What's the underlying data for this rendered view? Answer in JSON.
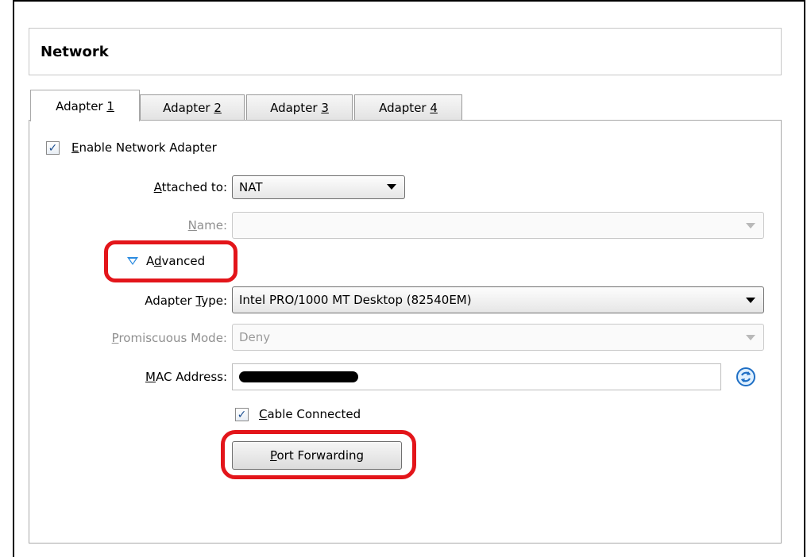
{
  "section": {
    "title": "Network"
  },
  "tabs": [
    {
      "prefix": "Adapter ",
      "key": "1"
    },
    {
      "prefix": "Adapter ",
      "key": "2"
    },
    {
      "prefix": "Adapter ",
      "key": "3"
    },
    {
      "prefix": "Adapter ",
      "key": "4"
    }
  ],
  "enable_adapter": {
    "label_key": "E",
    "label_rest": "nable Network Adapter",
    "checked": true
  },
  "attached_to": {
    "label_key": "A",
    "label_rest": "ttached to:",
    "value": "NAT"
  },
  "name": {
    "label_key": "N",
    "label_rest": "ame:",
    "value": ""
  },
  "advanced": {
    "label_pre": "A",
    "label_key": "d",
    "label_rest": "vanced"
  },
  "adapter_type": {
    "label_pre": "Adapter ",
    "label_key": "T",
    "label_rest": "ype:",
    "value": "Intel PRO/1000 MT Desktop (82540EM)"
  },
  "promiscuous_mode": {
    "label_key": "P",
    "label_rest": "romiscuous Mode:",
    "value": "Deny"
  },
  "mac_address": {
    "label_key": "M",
    "label_rest": "AC Address:"
  },
  "cable_connected": {
    "label_key": "C",
    "label_rest": "able Connected",
    "checked": true
  },
  "port_forwarding": {
    "label_key": "P",
    "label_rest": "ort Forwarding"
  },
  "colors": {
    "highlight": "#e3151a",
    "accent": "#2a8be0"
  },
  "icons": {
    "refresh": "refresh-icon",
    "check": "checkmark-icon",
    "disclosure": "triangle-down-icon"
  }
}
